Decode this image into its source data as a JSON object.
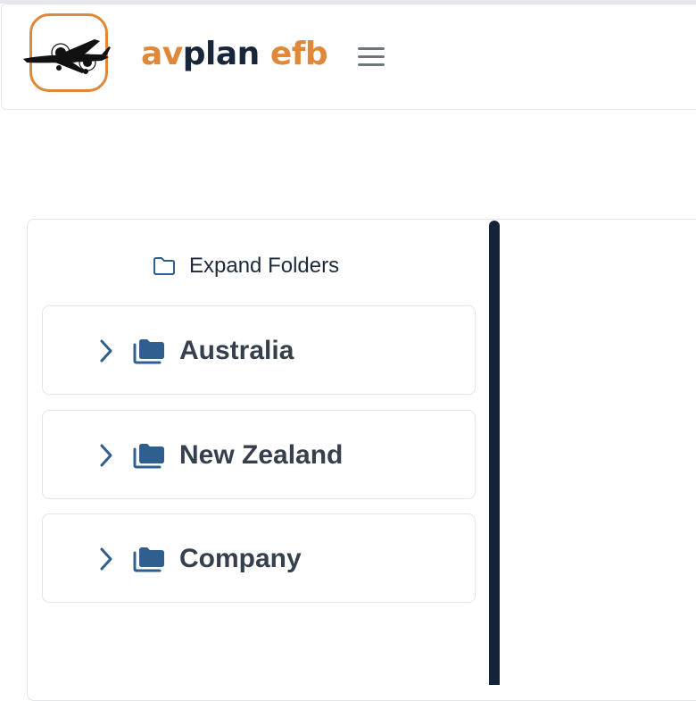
{
  "header": {
    "brand_av": "av",
    "brand_plan": "plan",
    "brand_efb": " efb",
    "logo_icon": "airplane-icon",
    "menu_icon": "hamburger-menu-icon"
  },
  "colors": {
    "accent": "#e0883a",
    "dark": "#17263a",
    "icon_blue": "#2f5f8f",
    "divider": "#142337"
  },
  "folders_panel": {
    "expand_label": "Expand Folders",
    "expand_icon": "folder-outline-icon",
    "items": [
      {
        "label": "Australia",
        "icon": "folder-icon",
        "chevron": "chevron-right-icon"
      },
      {
        "label": "New Zealand",
        "icon": "folder-icon",
        "chevron": "chevron-right-icon"
      },
      {
        "label": "Company",
        "icon": "folder-icon",
        "chevron": "chevron-right-icon"
      }
    ]
  }
}
